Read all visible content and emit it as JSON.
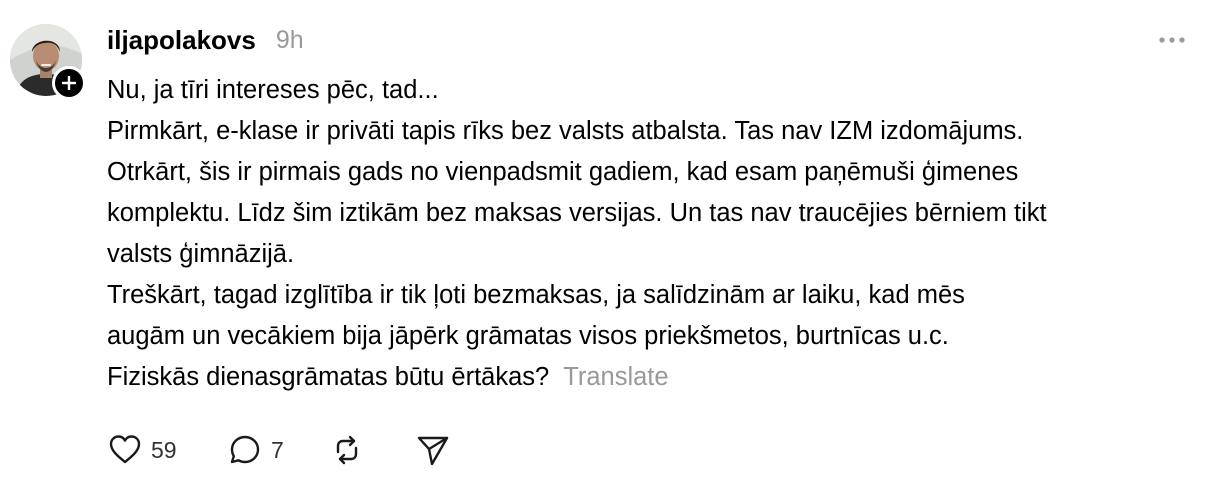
{
  "post": {
    "username": "iljapolakovs",
    "timestamp": "9h",
    "avatar_icon": "profile-photo",
    "follow_icon": "plus-icon",
    "more_icon": "ellipsis-icon",
    "paragraphs": [
      "Nu, ja tīri intereses pēc, tad...",
      "Pirmkārt, e-klase ir privāti tapis rīks bez valsts atbalsta. Tas nav IZM izdomājums.",
      "Otrkārt, šis ir pirmais gads no vienpadsmit gadiem, kad esam paņēmuši ģimenes",
      "komplektu. Līdz šim iztikām bez maksas versijas. Un tas nav traucējies bērniem tikt",
      "valsts ģimnāzijā.",
      "Treškārt, tagad izglītība ir tik ļoti bezmaksas, ja salīdzinām ar laiku, kad mēs",
      "augām un vecākiem bija jāpērk grāmatas visos priekšmetos, burtnīcas u.c.",
      "Fiziskās dienasgrāmatas būtu ērtākas?"
    ],
    "translate_label": "Translate"
  },
  "actions": {
    "likes": "59",
    "replies": "7"
  },
  "colors": {
    "text": "#000000",
    "muted": "#999999",
    "icon": "#1a1a1a"
  }
}
